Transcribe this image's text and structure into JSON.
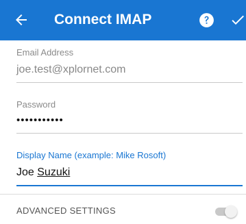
{
  "appbar": {
    "title": "Connect IMAP",
    "back_icon": "arrow-left-icon",
    "help_icon": "help-circle-icon",
    "confirm_icon": "check-icon",
    "background_color": "#1976D2"
  },
  "form": {
    "email": {
      "label": "Email Address",
      "value": "joe.test@xplornet.com"
    },
    "password": {
      "label": "Password",
      "value": "•••••••••••"
    },
    "display_name": {
      "label": "Display Name (example: Mike Rosoft)",
      "value_first": "Joe ",
      "value_last": "Suzuki",
      "focused": true
    }
  },
  "advanced": {
    "label": "ADVANCED SETTINGS",
    "enabled": false
  },
  "colors": {
    "accent": "#1976D2",
    "label_gray": "#8a8a8a",
    "divider": "#dcdcdc"
  }
}
